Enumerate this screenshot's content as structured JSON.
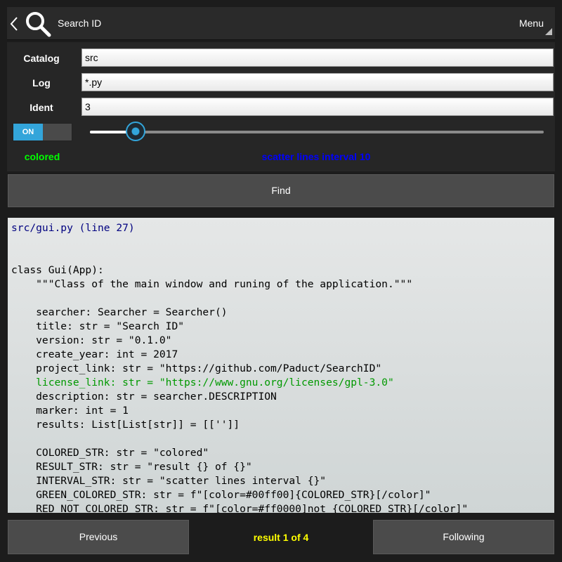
{
  "colors": {
    "accent": "#33a5da",
    "colored_label": "#00ff00",
    "interval_label": "#0000ff",
    "result_label": "#ffff00",
    "path_text": "#000080",
    "highlight_line": "#009900"
  },
  "header": {
    "back_icon": "chevron-left-icon",
    "search_icon": "magnifier-icon",
    "title": "Search ID",
    "menu_label": "Menu"
  },
  "form": {
    "catalog": {
      "label": "Catalog",
      "value": "src"
    },
    "log": {
      "label": "Log",
      "value": "*.py"
    },
    "ident": {
      "label": "Ident",
      "value": "3"
    },
    "toggle": {
      "label": "ON",
      "state": "on"
    },
    "slider": {
      "value_fraction": 0.1
    },
    "colored_label": "colored",
    "interval_label": "scatter lines interval 10",
    "find_button": "Find"
  },
  "code": {
    "lines": [
      {
        "text": "src/gui.py (line 27)",
        "color": "#000080"
      },
      {
        "text": "",
        "color": "#000000"
      },
      {
        "text": "",
        "color": "#000000"
      },
      {
        "text": "class Gui(App):",
        "color": "#000000"
      },
      {
        "text": "    \"\"\"Class of the main window and runing of the application.\"\"\"",
        "color": "#000000"
      },
      {
        "text": "",
        "color": "#000000"
      },
      {
        "text": "    searcher: Searcher = Searcher()",
        "color": "#000000"
      },
      {
        "text": "    title: str = \"Search ID\"",
        "color": "#000000"
      },
      {
        "text": "    version: str = \"0.1.0\"",
        "color": "#000000"
      },
      {
        "text": "    create_year: int = 2017",
        "color": "#000000"
      },
      {
        "text": "    project_link: str = \"https://github.com/Paduct/SearchID\"",
        "color": "#000000"
      },
      {
        "text": "    license_link: str = \"https://www.gnu.org/licenses/gpl-3.0\"",
        "color": "#009900"
      },
      {
        "text": "    description: str = searcher.DESCRIPTION",
        "color": "#000000"
      },
      {
        "text": "    marker: int = 1",
        "color": "#000000"
      },
      {
        "text": "    results: List[List[str]] = [['']]",
        "color": "#000000"
      },
      {
        "text": "",
        "color": "#000000"
      },
      {
        "text": "    COLORED_STR: str = \"colored\"",
        "color": "#000000"
      },
      {
        "text": "    RESULT_STR: str = \"result {} of {}\"",
        "color": "#000000"
      },
      {
        "text": "    INTERVAL_STR: str = \"scatter lines interval {}\"",
        "color": "#000000"
      },
      {
        "text": "    GREEN_COLORED_STR: str = f\"[color=#00ff00]{COLORED_STR}[/color]\"",
        "color": "#000000"
      },
      {
        "text": "    RED_NOT_COLORED_STR: str = f\"[color=#ff0000]not {COLORED_STR}[/color]\"",
        "color": "#000000"
      }
    ]
  },
  "footer": {
    "previous_button": "Previous",
    "result_label": "result 1 of 4",
    "following_button": "Following"
  }
}
